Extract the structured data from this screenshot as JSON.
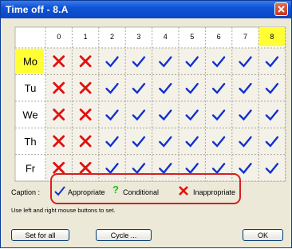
{
  "window": {
    "title": "Time off - 8.A"
  },
  "grid": {
    "columns": [
      "0",
      "1",
      "2",
      "3",
      "4",
      "5",
      "6",
      "7",
      "8"
    ],
    "highlighted_column": "8",
    "rows": [
      {
        "label": "Mo",
        "highlighted": true,
        "cells": [
          "x",
          "x",
          "v",
          "v",
          "v",
          "v",
          "v",
          "v",
          "v"
        ]
      },
      {
        "label": "Tu",
        "highlighted": false,
        "cells": [
          "x",
          "x",
          "v",
          "v",
          "v",
          "v",
          "v",
          "v",
          "v"
        ]
      },
      {
        "label": "We",
        "highlighted": false,
        "cells": [
          "x",
          "x",
          "v",
          "v",
          "v",
          "v",
          "v",
          "v",
          "v"
        ]
      },
      {
        "label": "Th",
        "highlighted": false,
        "cells": [
          "x",
          "x",
          "v",
          "v",
          "v",
          "v",
          "v",
          "v",
          "v"
        ]
      },
      {
        "label": "Fr",
        "highlighted": false,
        "cells": [
          "x",
          "x",
          "v",
          "v",
          "v",
          "v",
          "v",
          "v",
          "v"
        ]
      }
    ],
    "colors": {
      "appropriate": "#1030d0",
      "conditional": "#12c812",
      "inappropriate": "#e01010",
      "highlight": "#ffff33"
    }
  },
  "legend": {
    "caption": "Caption :",
    "appropriate": "Appropriate",
    "conditional": "Conditional",
    "inappropriate": "Inappropriate",
    "conditional_symbol": "?"
  },
  "hint": "Use left and right mouse buttons to set.",
  "buttons": {
    "set_for_all": "Set for all",
    "cycle": "Cycle ...",
    "ok": "OK"
  }
}
